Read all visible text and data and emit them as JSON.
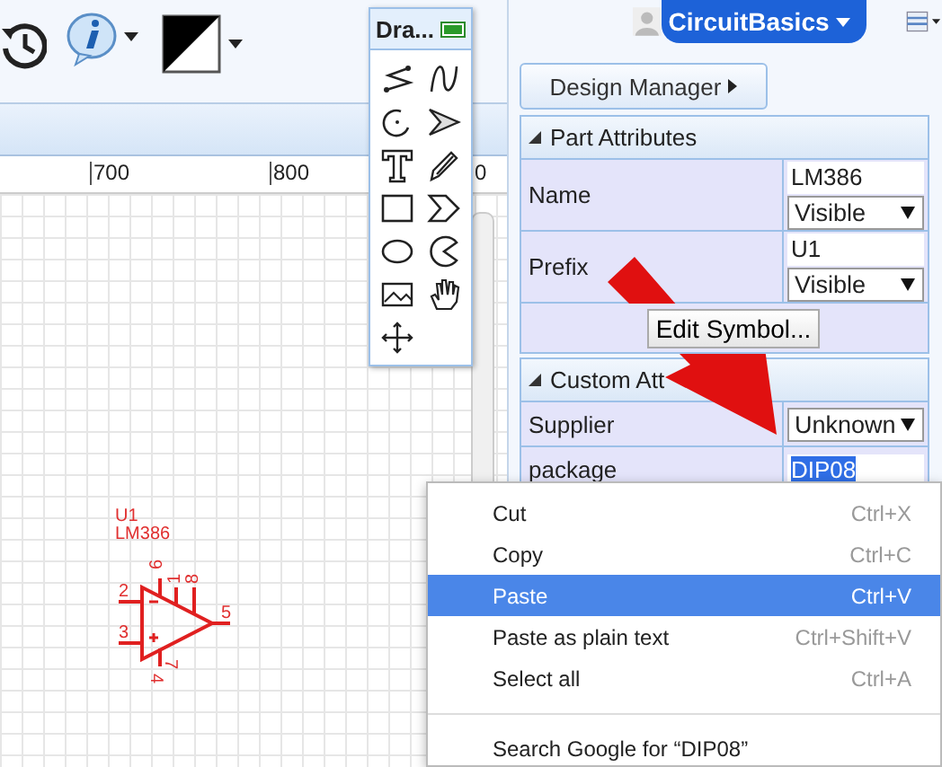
{
  "toolbar": {
    "user": "CircuitBasics"
  },
  "ruler": {
    "labels": [
      "700",
      "800",
      "0"
    ]
  },
  "palette": {
    "title": "Dra..."
  },
  "schematic": {
    "designator": "U1",
    "part": "LM386",
    "pins": [
      "6",
      "1",
      "8",
      "2",
      "3",
      "5",
      "7",
      "4"
    ]
  },
  "design_manager": {
    "label": "Design Manager"
  },
  "part_attributes": {
    "title": "Part Attributes",
    "rows": [
      {
        "label": "Name",
        "value": "LM386",
        "visibility": "Visible"
      },
      {
        "label": "Prefix",
        "value": "U1",
        "visibility": "Visible"
      }
    ],
    "edit_button": "Edit Symbol..."
  },
  "custom_attributes": {
    "title": "Custom Att",
    "rows": [
      {
        "label": "Supplier",
        "kind": "select",
        "value": "Unknown"
      },
      {
        "label": "package",
        "kind": "input",
        "value": "DIP08",
        "selected": true
      }
    ]
  },
  "context_menu": {
    "items": [
      {
        "label": "Cut",
        "shortcut": "Ctrl+X",
        "selected": false
      },
      {
        "label": "Copy",
        "shortcut": "Ctrl+C",
        "selected": false
      },
      {
        "label": "Paste",
        "shortcut": "Ctrl+V",
        "selected": true
      },
      {
        "label": "Paste as plain text",
        "shortcut": "Ctrl+Shift+V",
        "selected": false
      },
      {
        "label": "Select all",
        "shortcut": "Ctrl+A",
        "selected": false
      },
      {
        "kind": "separator"
      },
      {
        "label": "Search Google for “DIP08”",
        "selected": false
      }
    ]
  }
}
